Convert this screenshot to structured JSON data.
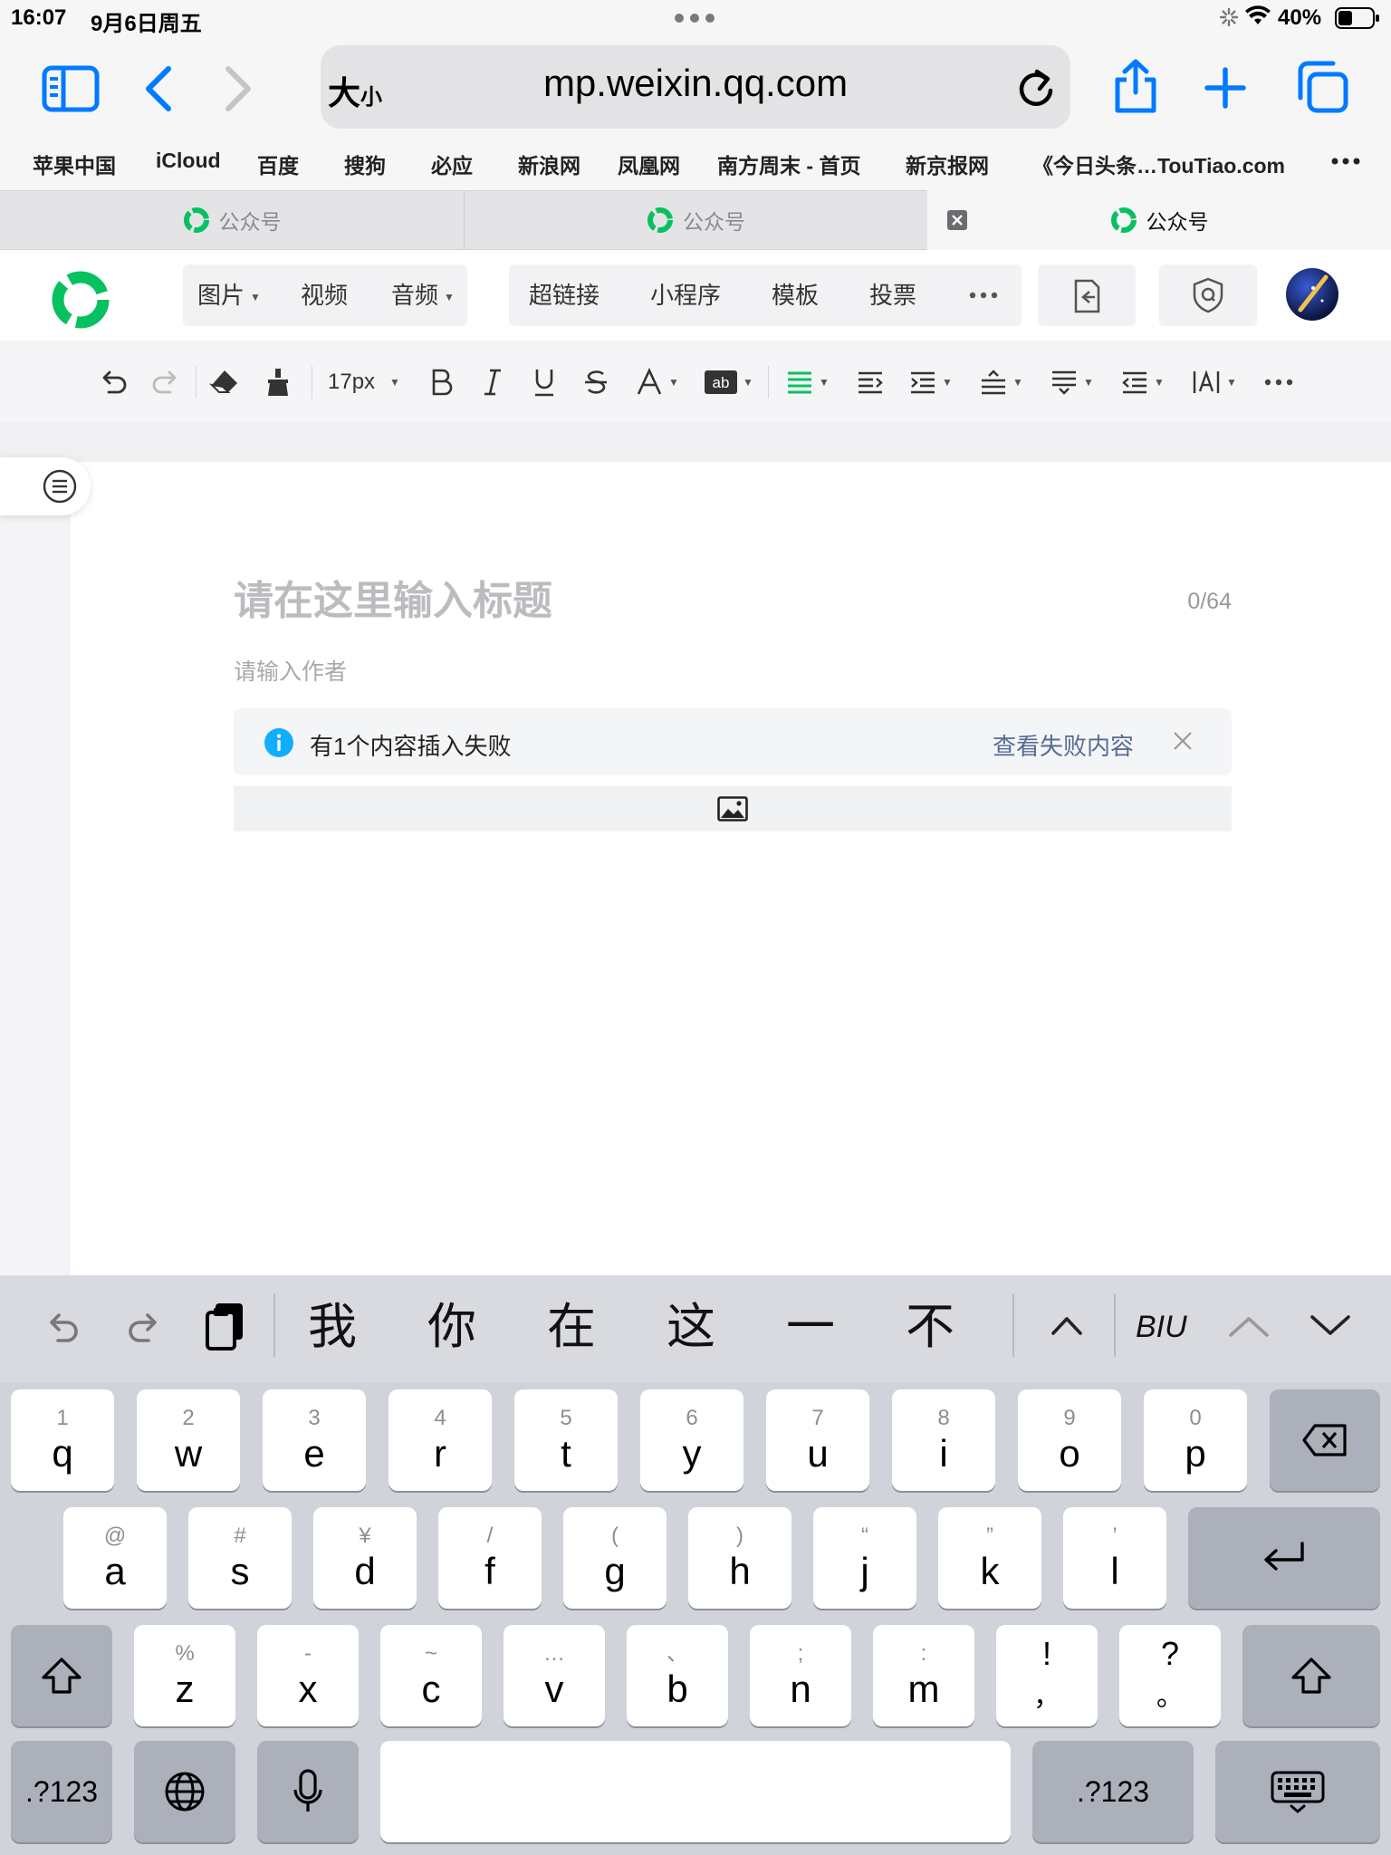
{
  "status": {
    "time": "16:07",
    "date": "9月6日周五",
    "battery": "40%"
  },
  "browser": {
    "url": "mp.weixin.qq.com",
    "text_size_label": "大",
    "text_size_small": "小",
    "bookmarks": [
      "苹果中国",
      "iCloud",
      "百度",
      "搜狗",
      "必应",
      "新浪网",
      "凤凰网",
      "南方周末 - 首页",
      "新京报网",
      "《今日头条…TouTiao.com"
    ],
    "tabs": [
      {
        "label": "公众号"
      },
      {
        "label": "公众号"
      },
      {
        "label": "公众号",
        "active": true
      }
    ]
  },
  "toolbar1": {
    "group1": [
      "图片",
      "视频",
      "音频"
    ],
    "group2": [
      "超链接",
      "小程序",
      "模板",
      "投票"
    ]
  },
  "toolbar2": {
    "font_size": "17px"
  },
  "editor": {
    "title_placeholder": "请在这里输入标题",
    "title_count": "0/64",
    "author_placeholder": "请输入作者",
    "notice_text": "有1个内容插入失败",
    "notice_link": "查看失败内容"
  },
  "keyboard": {
    "candidates": [
      "我",
      "你",
      "在",
      "这",
      "一",
      "不"
    ],
    "format_label": "BIU",
    "row1": [
      {
        "k": "q",
        "s": "1"
      },
      {
        "k": "w",
        "s": "2"
      },
      {
        "k": "e",
        "s": "3"
      },
      {
        "k": "r",
        "s": "4"
      },
      {
        "k": "t",
        "s": "5"
      },
      {
        "k": "y",
        "s": "6"
      },
      {
        "k": "u",
        "s": "7"
      },
      {
        "k": "i",
        "s": "8"
      },
      {
        "k": "o",
        "s": "9"
      },
      {
        "k": "p",
        "s": "0"
      }
    ],
    "row2": [
      {
        "k": "a",
        "s": "@"
      },
      {
        "k": "s",
        "s": "#"
      },
      {
        "k": "d",
        "s": "¥"
      },
      {
        "k": "f",
        "s": "/"
      },
      {
        "k": "g",
        "s": "("
      },
      {
        "k": "h",
        "s": ")"
      },
      {
        "k": "j",
        "s": "“"
      },
      {
        "k": "k",
        "s": "”"
      },
      {
        "k": "l",
        "s": "’"
      }
    ],
    "row3": [
      {
        "k": "z",
        "s": "%"
      },
      {
        "k": "x",
        "s": "-"
      },
      {
        "k": "c",
        "s": "~"
      },
      {
        "k": "v",
        "s": "…"
      },
      {
        "k": "b",
        "s": "、"
      },
      {
        "k": "n",
        "s": ";"
      },
      {
        "k": "m",
        "s": ":"
      },
      {
        "k": "，",
        "s": "!"
      },
      {
        "k": "。",
        "s": "?"
      }
    ],
    "numbers_label": ".?123"
  },
  "colors": {
    "accent": "#007aff",
    "wechat_green": "#07c160",
    "link": "#576b95",
    "info": "#10aeff"
  }
}
